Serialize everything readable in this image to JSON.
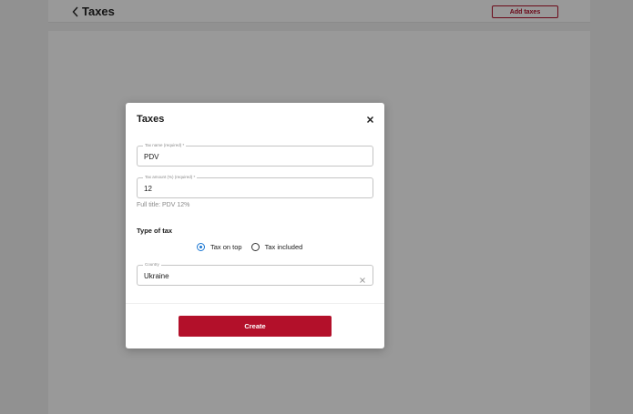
{
  "header": {
    "back_icon": "chevron-left-icon",
    "title": "Taxes",
    "add_button_label": "Add taxes"
  },
  "modal": {
    "title": "Taxes",
    "close_icon": "close-icon",
    "fields": {
      "tax_name": {
        "label": "Tax name (required) *",
        "value": "PDV"
      },
      "tax_amount": {
        "label": "Tax amount (%) (required) *",
        "value": "12"
      },
      "country": {
        "label": "Country",
        "value": "Ukraine",
        "clear_icon": "clear-icon"
      }
    },
    "full_title_text": "Full title: PDV 12%",
    "type_of_tax": {
      "title": "Type of tax",
      "options": [
        {
          "label": "Tax on top",
          "selected": true
        },
        {
          "label": "Tax included",
          "selected": false
        }
      ]
    },
    "create_button_label": "Create"
  },
  "colors": {
    "brand": "#b3102a",
    "radio_selected": "#1976d2",
    "overlay": "rgba(0,0,0,0.40)"
  }
}
